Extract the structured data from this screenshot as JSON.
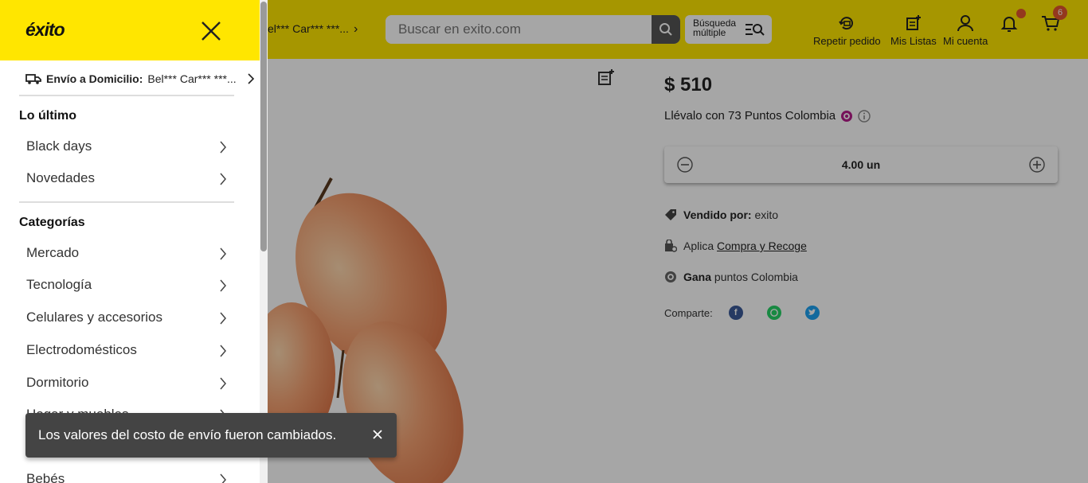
{
  "header": {
    "address_text": "el*** Car*** ***...",
    "search_placeholder": "Buscar en exito.com",
    "multi_search_line1": "Búsqueda",
    "multi_search_line2": "múltiple",
    "repeat_order_label": "Repetir pedido",
    "my_lists_label": "Mis Listas",
    "my_account_label": "Mi cuenta",
    "cart_count": "6"
  },
  "product": {
    "price": "$ 510",
    "points_text": "Llévalo con 73 Puntos Colombia",
    "quantity": "4.00 un",
    "sold_by_label": "Vendido por:",
    "sold_by_value": "exito",
    "pickup_prefix": "Aplica",
    "pickup_link": "Compra y Recoge",
    "points_prefix": "Gana",
    "points_suffix": "puntos Colombia",
    "share_label": "Comparte:"
  },
  "drawer": {
    "logo_text": "éxito",
    "delivery_label": "Envío a Domicilio:",
    "delivery_address": "Bel*** Car*** ***...",
    "section_latest": "Lo último",
    "latest_items": [
      "Black days",
      "Novedades"
    ],
    "section_categories": "Categorías",
    "category_items": [
      "Mercado",
      "Tecnología",
      "Celulares y accesorios",
      "Electrodomésticos",
      "Dormitorio",
      "Hogar y muebles",
      "Bebés"
    ]
  },
  "toast": {
    "message": "Los valores del costo de envío fueron cambiados."
  },
  "colors": {
    "brand_yellow": "#FFE600",
    "badge": "#e4572e",
    "facebook": "#3b5998",
    "whatsapp": "#25D366",
    "twitter": "#1DA1F2"
  },
  "icons": [
    "truck-icon",
    "close-icon",
    "chevron-right-icon",
    "search-icon",
    "multi-search-icon",
    "repeat-order-icon",
    "list-add-icon",
    "user-icon",
    "bell-icon",
    "cart-icon",
    "minus-circle-icon",
    "plus-circle-icon",
    "tag-icon",
    "store-pickup-icon",
    "puntos-colombia-icon",
    "info-icon",
    "facebook-icon",
    "whatsapp-icon",
    "twitter-icon"
  ]
}
